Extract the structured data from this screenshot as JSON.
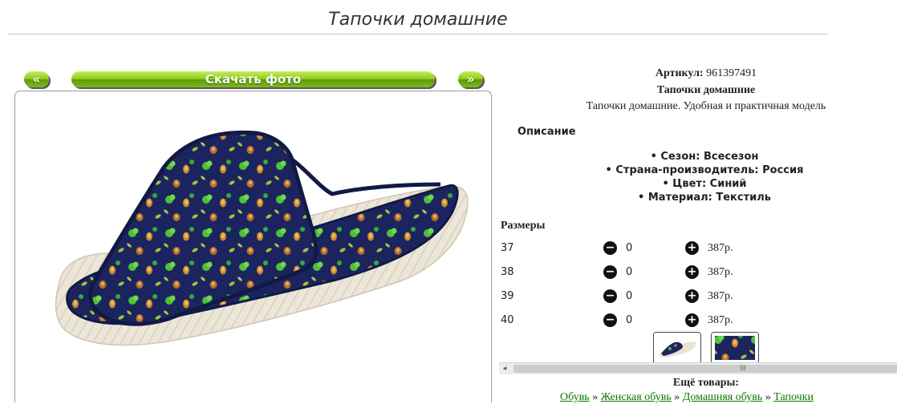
{
  "page": {
    "title": "Тапочки домашние"
  },
  "gallery": {
    "prev_label": "«",
    "download_label": "Скачать фото",
    "next_label": "»"
  },
  "product": {
    "article_label": "Артикул:",
    "article_value": "961397491",
    "name": "Тапочки домашние",
    "description": "Тапочки домашние. Удобная и практичная модель",
    "description_heading": "Описание",
    "properties": [
      "• Сезон: Всесезон",
      "• Страна-производитель: Россия",
      "• Цвет: Синий",
      "• Материал: Текстиль"
    ],
    "sizes_heading": "Размеры",
    "sizes": [
      {
        "size": "37",
        "qty": "0",
        "price": "387р."
      },
      {
        "size": "38",
        "qty": "0",
        "price": "387р."
      },
      {
        "size": "39",
        "qty": "0",
        "price": "387р."
      },
      {
        "size": "40",
        "qty": "0",
        "price": "387р."
      }
    ],
    "minus_icon": "minus-circle-icon",
    "plus_icon": "plus-circle-icon"
  },
  "scrollbar": {
    "left_arrow": "◂",
    "grip": "III"
  },
  "more": {
    "heading": "Ещё товары:",
    "crumbs": [
      "Обувь",
      "Женская обувь",
      "Домашняя обувь",
      "Тапочки"
    ],
    "separator": " » "
  },
  "colors": {
    "accent_green": "#8ccc1c",
    "link_green": "#0a7a00",
    "slipper_navy": "#1a2257"
  }
}
